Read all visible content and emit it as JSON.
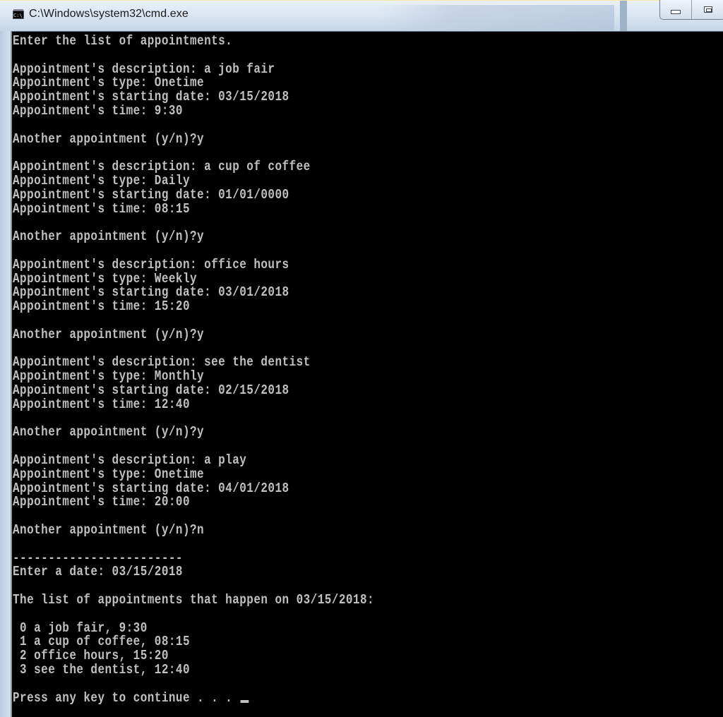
{
  "window": {
    "title": "C:\\Windows\\system32\\cmd.exe",
    "icon": "cmd-icon",
    "icon_text": "C:\\_",
    "controls": [
      "minimize-icon",
      "maximize-icon"
    ]
  },
  "colors": {
    "console_bg": "#000000",
    "console_text": "#c0c0c0"
  },
  "console": {
    "lines": [
      "Enter the list of appointments.",
      "",
      "Appointment's description: a job fair",
      "Appointment's type: Onetime",
      "Appointment's starting date: 03/15/2018",
      "Appointment's time: 9:30",
      "",
      "Another appointment (y/n)?y",
      "",
      "Appointment's description: a cup of coffee",
      "Appointment's type: Daily",
      "Appointment's starting date: 01/01/0000",
      "Appointment's time: 08:15",
      "",
      "Another appointment (y/n)?y",
      "",
      "Appointment's description: office hours",
      "Appointment's type: Weekly",
      "Appointment's starting date: 03/01/2018",
      "Appointment's time: 15:20",
      "",
      "Another appointment (y/n)?y",
      "",
      "Appointment's description: see the dentist",
      "Appointment's type: Monthly",
      "Appointment's starting date: 02/15/2018",
      "Appointment's time: 12:40",
      "",
      "Another appointment (y/n)?y",
      "",
      "Appointment's description: a play",
      "Appointment's type: Onetime",
      "Appointment's starting date: 04/01/2018",
      "Appointment's time: 20:00",
      "",
      "Another appointment (y/n)?n",
      "",
      "------------------------",
      "Enter a date: 03/15/2018",
      "",
      "The list of appointments that happen on 03/15/2018:",
      "",
      " 0 a job fair, 9:30",
      " 1 a cup of coffee, 08:15",
      " 2 office hours, 15:20",
      " 3 see the dentist, 12:40",
      "",
      "Press any key to continue . . . "
    ],
    "cursor": "text-cursor"
  }
}
